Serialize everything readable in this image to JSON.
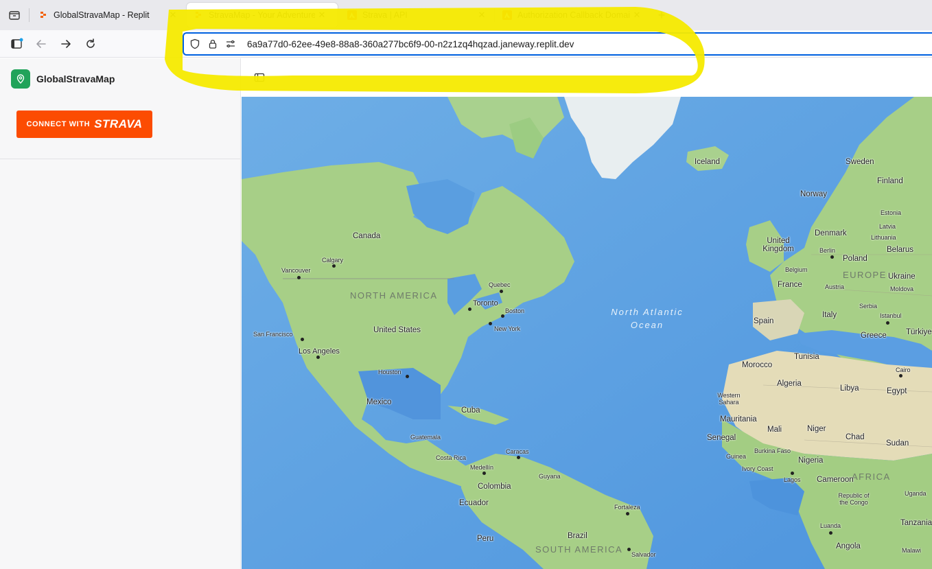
{
  "browser": {
    "tabs": [
      {
        "title": "GlobalStravaMap - Replit",
        "favicon": "replit-icon",
        "active": false
      },
      {
        "title": "StravaMap - Your Adventures",
        "favicon": "replit-icon",
        "active": true
      },
      {
        "title": "Strava | API",
        "favicon": "strava-icon",
        "active": false
      },
      {
        "title": "Authorization Callback Domain",
        "favicon": "strava-icon",
        "active": false
      }
    ],
    "url": "6a9a77d0-62ee-49e8-88a8-360a277bc6f9-00-n2z1zq4hqzad.janeway.replit.dev",
    "highlight_color": "#f5ea00"
  },
  "app": {
    "name": "GlobalStravaMap",
    "brand_color": "#21a35a",
    "connect_button": {
      "prefix": "CONNECT WITH",
      "brand": "STRAVA",
      "color": "#fc4c02"
    }
  },
  "map": {
    "continents": [
      "NORTH AMERICA",
      "EUROPE",
      "AFRICA",
      "SOUTH AMERICA"
    ],
    "ocean": "North Atlantic Ocean",
    "countries": [
      "Canada",
      "United States",
      "Mexico",
      "Cuba",
      "Guatemala",
      "Costa Rica",
      "Colombia",
      "Ecuador",
      "Peru",
      "Brazil",
      "Guyana",
      "Iceland",
      "Norway",
      "Sweden",
      "Finland",
      "Estonia",
      "Latvia",
      "Lithuania",
      "Belarus",
      "Denmark",
      "United Kingdom",
      "Belgium",
      "Poland",
      "Ukraine",
      "Moldova",
      "France",
      "Austria",
      "Serbia",
      "Italy",
      "Spain",
      "Greece",
      "Türkiye",
      "Tunisia",
      "Morocco",
      "Algeria",
      "Libya",
      "Egypt",
      "Western Sahara",
      "Mauritania",
      "Mali",
      "Niger",
      "Chad",
      "Sudan",
      "Senegal",
      "Guinea",
      "Burkina Faso",
      "Nigeria",
      "Ivory Coast",
      "Cameroon",
      "Republic of the Congo",
      "Uganda",
      "Tanzania",
      "Angola",
      "Malawi"
    ],
    "cities": [
      "Vancouver",
      "Calgary",
      "San Francisco",
      "Los Angeles",
      "Houston",
      "Toronto",
      "Quebec",
      "Boston",
      "New York",
      "Caracas",
      "Medellín",
      "Fortaleza",
      "Salvador",
      "Berlin",
      "Istanbul",
      "Cairo",
      "Lagos",
      "Luanda"
    ]
  }
}
